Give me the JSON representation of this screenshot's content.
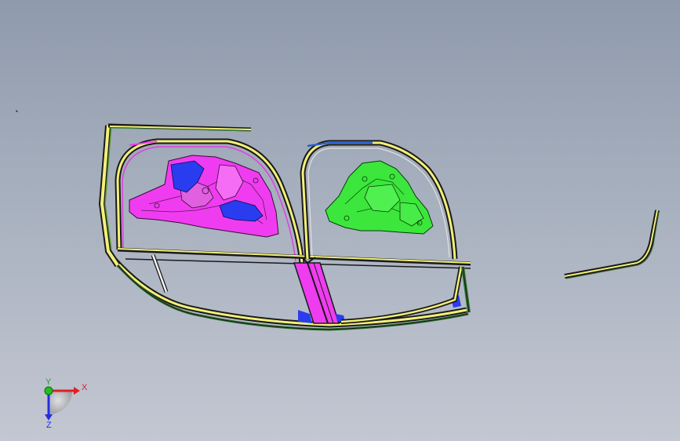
{
  "viewport": {
    "background_top": "#8f9aac",
    "background_bottom": "#c3c7d2"
  },
  "model": {
    "parts": [
      {
        "name": "front-door-frame",
        "color": "#f2f07a"
      },
      {
        "name": "rear-door-frame",
        "color": "#f2f07a"
      },
      {
        "name": "front-inner-panel",
        "color": "#f03cf0"
      },
      {
        "name": "rear-inner-panel",
        "color": "#3ce63c"
      },
      {
        "name": "b-pillar",
        "color": "#f03cf0"
      },
      {
        "name": "blue-reinforcements",
        "color": "#2a3cf0"
      },
      {
        "name": "detached-trim-strip",
        "color": "#f2f07a"
      }
    ]
  },
  "triad": {
    "x_label": "X",
    "y_label": "Y",
    "z_label": "Z",
    "x_color": "#e02020",
    "y_color": "#20c020",
    "z_color": "#2030e0"
  }
}
